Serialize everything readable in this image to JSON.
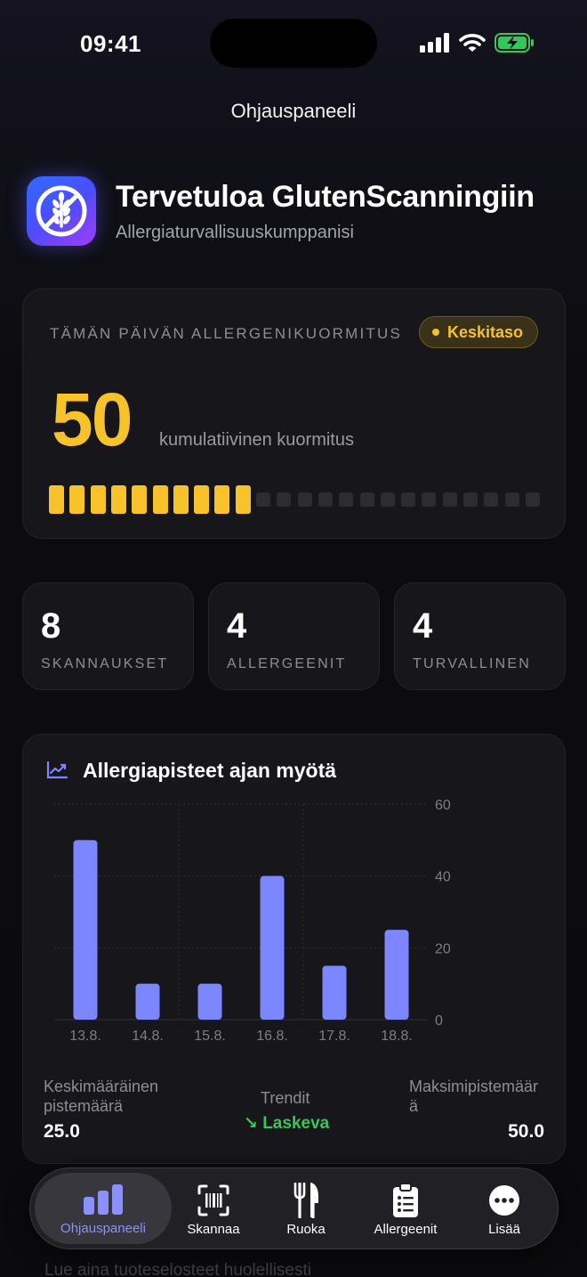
{
  "status_bar": {
    "time": "09:41"
  },
  "nav": {
    "title": "Ohjauspaneeli"
  },
  "welcome": {
    "title": "Tervetuloa GlutenScanningiin",
    "subtitle": "Allergiaturvallisuuskumppanisi",
    "icon": "crossed-wheat-icon"
  },
  "load": {
    "label": "TÄMÄN PÄIVÄN ALLERGENIKUORMITUS",
    "badge": "Keskitaso",
    "score": "50",
    "score_label": "kumulatiivinen kuormitus",
    "segments_filled": 10,
    "segments_total": 24,
    "accent_color": "#F7C22A"
  },
  "stats": [
    {
      "value": "8",
      "label": "SKANNAUKSET"
    },
    {
      "value": "4",
      "label": "ALLERGEENIT"
    },
    {
      "value": "4",
      "label": "TURVALLINEN"
    }
  ],
  "chart_section": {
    "title": "Allergiapisteet ajan myötä",
    "icon": "trend-chart-icon",
    "average_label": "Keskimääräinen\npistemäärä",
    "average_value": "25.0",
    "trend_label": "Trendit",
    "trend_value": "↘ Laskeva",
    "max_label": "Maksimipistemäär\nä",
    "max_value": "50.0"
  },
  "chart_data": {
    "type": "bar",
    "categories": [
      "13.8.",
      "14.8.",
      "15.8.",
      "16.8.",
      "17.8.",
      "18.8."
    ],
    "values": [
      50,
      10,
      10,
      40,
      15,
      25
    ],
    "ylim": [
      0,
      60
    ],
    "yticks": [
      0,
      20,
      40,
      60
    ],
    "grid": true,
    "bar_color": "#7B86FF"
  },
  "ghost_text": "Lue aina tuoteselosteet huolellisesti",
  "tabs": [
    {
      "label": "Ohjauspaneeli",
      "icon": "bar-chart-icon",
      "active": true
    },
    {
      "label": "Skannaa",
      "icon": "barcode-scan-icon",
      "active": false
    },
    {
      "label": "Ruoka",
      "icon": "fork-knife-icon",
      "active": false
    },
    {
      "label": "Allergeenit",
      "icon": "clipboard-list-icon",
      "active": false
    },
    {
      "label": "Lisää",
      "icon": "more-ellipsis-icon",
      "active": false
    }
  ]
}
